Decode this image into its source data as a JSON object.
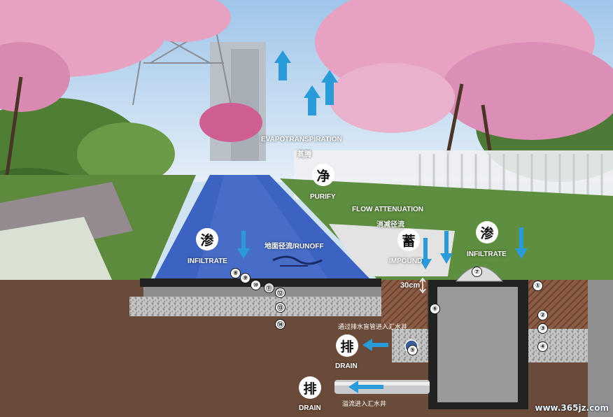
{
  "labels": {
    "evapo_en": "EVAPOTRANSPIRATION",
    "evapo_cn": "蒸腾",
    "purify_en": "PURIFY",
    "flow_en": "FLOW ATTENUATION",
    "flow_cn": "消减径流",
    "runoff": "地面径流/RUNOFF",
    "infiltrate_en": "INFILTRATE",
    "impound_en": "IMPOUND",
    "drain_en": "DRAIN",
    "depth": "30cm"
  },
  "icons": {
    "purify": "净",
    "infiltrate": "渗",
    "impound": "蓄",
    "drain": "排"
  },
  "notes": {
    "blind_pipe": "通过排水盲管进入汇水井",
    "overflow": "溢流进入汇水井"
  },
  "callouts": [
    "①",
    "②",
    "③",
    "④",
    "⑤",
    "⑥",
    "⑦",
    "⑧",
    "⑨",
    "⑩",
    "⑪",
    "⑫",
    "⑬",
    "⑭"
  ],
  "watermark": "www.365jz.com",
  "colors": {
    "soil": "#6a4a38",
    "path": "#3d63c2",
    "arrow": "#2a9ad8",
    "blossom": "#e7a2c2",
    "foliage": "#5a8f3a",
    "gravel": "#bdbdbd",
    "well": "#9a9a9a"
  }
}
